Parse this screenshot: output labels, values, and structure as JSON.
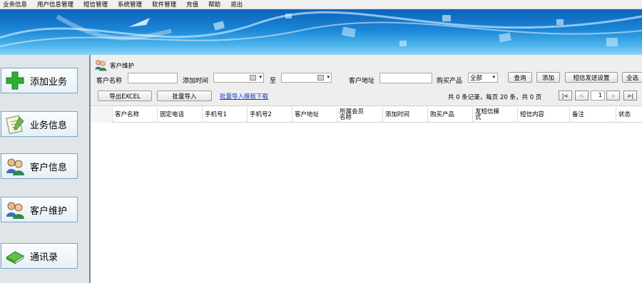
{
  "menu": [
    "业务信息",
    "用户信息管理",
    "短信管理",
    "系统管理",
    "软件管理",
    "充值",
    "帮助",
    "退出"
  ],
  "sidebar": [
    {
      "label": "添加业务",
      "icon": "plus-icon"
    },
    {
      "label": "业务信息",
      "icon": "notepad-icon"
    },
    {
      "label": "客户信息",
      "icon": "users-icon"
    },
    {
      "label": "客户维护",
      "icon": "users-icon"
    },
    {
      "label": "通讯录",
      "icon": "book-icon"
    }
  ],
  "panel_title": "客户维护",
  "filters": {
    "name_label": "客户名称",
    "time_label": "添加时间",
    "to_label": "至",
    "address_label": "客户地址",
    "product_label": "购买产品",
    "product_value": "全部"
  },
  "buttons": {
    "query": "查询",
    "add": "添加",
    "sms_settings": "短信发送设置",
    "select_all": "全选",
    "export": "导出EXCEL",
    "batch_import": "批量导入",
    "template_link": "批量导入模板下载"
  },
  "pagination": {
    "summary": "共 0 条记录，每页 20 条，共 0 页",
    "first": "|<",
    "prev": "<",
    "page": "1",
    "next": ">",
    "last": ">|"
  },
  "columns": [
    "客户名称",
    "固定电话",
    "手机号1",
    "手机号2",
    "客户地址",
    "所属会员名称",
    "添加时间",
    "购买产品",
    "发短信模式",
    "短信内容",
    "备注",
    "状态"
  ]
}
